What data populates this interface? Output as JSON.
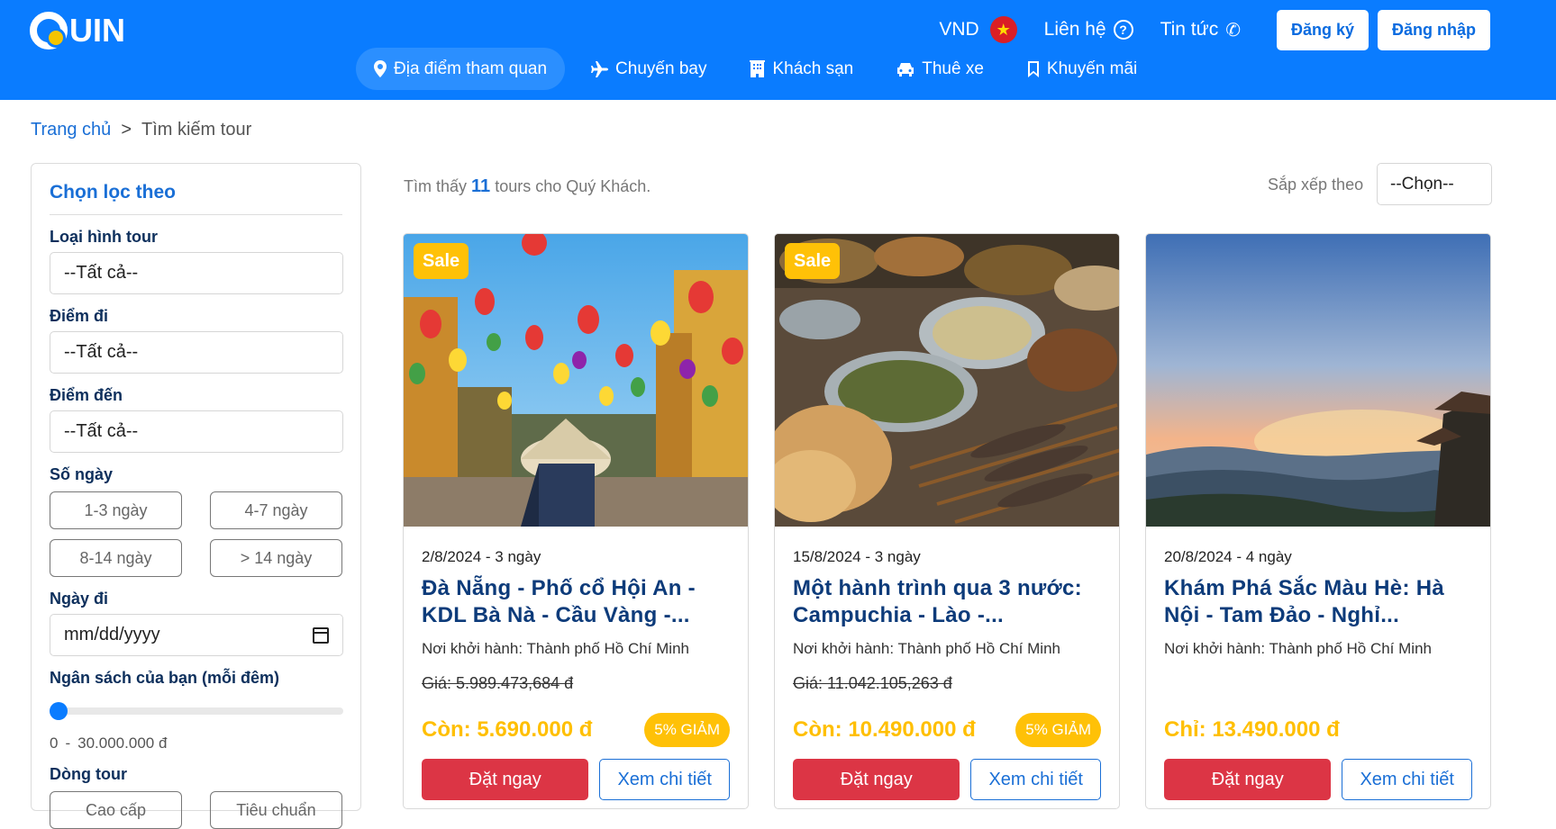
{
  "header": {
    "logo_text": "UIN",
    "currency": "VND",
    "contact": "Liên hệ",
    "news": "Tin tức",
    "register": "Đăng ký",
    "login": "Đăng nhập",
    "nav": [
      {
        "label": "Địa điểm tham quan",
        "icon": "map-pin-icon"
      },
      {
        "label": "Chuyến bay",
        "icon": "plane-icon"
      },
      {
        "label": "Khách sạn",
        "icon": "hotel-icon"
      },
      {
        "label": "Thuê xe",
        "icon": "car-icon"
      },
      {
        "label": "Khuyến mãi",
        "icon": "bookmark-icon"
      }
    ]
  },
  "breadcrumb": {
    "home": "Trang chủ",
    "separator": ">",
    "current": "Tìm kiếm tour"
  },
  "filter": {
    "title": "Chọn lọc theo",
    "tour_type_label": "Loại hình tour",
    "tour_type_value": "--Tất cả--",
    "departure_label": "Điểm đi",
    "departure_value": "--Tất cả--",
    "destination_label": "Điểm đến",
    "destination_value": "--Tất cả--",
    "days_label": "Số ngày",
    "days_options": [
      "1-3 ngày",
      "4-7 ngày",
      "8-14 ngày",
      "> 14 ngày"
    ],
    "date_label": "Ngày đi",
    "date_placeholder": "mm/dd/yyyy",
    "budget_label": "Ngân sách của bạn (mỗi đêm)",
    "budget_min": "0",
    "budget_dash": "-",
    "budget_max": "30.000.000 đ",
    "budget_level": 0,
    "line_label": "Dòng tour",
    "line_options": [
      "Cao cấp",
      "Tiêu chuẩn"
    ]
  },
  "results": {
    "prefix": "Tìm thấy",
    "count": "11",
    "suffix": "tours cho Quý Khách.",
    "sort_label": "Sắp xếp theo",
    "sort_value": "--Chọn--"
  },
  "tours": [
    {
      "badge": "Sale",
      "date": "2/8/2024 - 3 ngày",
      "title": "Đà Nẵng - Phố cổ Hội An - KDL Bà Nà - Cầu Vàng -...",
      "from": "Nơi khởi hành: Thành phố Hồ Chí Minh",
      "old_price": "Giá: 5.989.473,684 đ",
      "price": "Còn: 5.690.000 đ",
      "discount": "5% GIẢM",
      "book": "Đặt ngay",
      "detail": "Xem chi tiết"
    },
    {
      "badge": "Sale",
      "date": "15/8/2024 - 3 ngày",
      "title": "Một hành trình qua 3 nước: Campuchia - Lào -...",
      "from": "Nơi khởi hành: Thành phố Hồ Chí Minh",
      "old_price": "Giá: 11.042.105,263 đ",
      "price": "Còn: 10.490.000 đ",
      "discount": "5% GIẢM",
      "book": "Đặt ngay",
      "detail": "Xem chi tiết"
    },
    {
      "badge": "",
      "date": "20/8/2024 - 4 ngày",
      "title": "Khám Phá Sắc Màu Hè: Hà Nội - Tam Đảo - Nghỉ...",
      "from": "Nơi khởi hành: Thành phố Hồ Chí Minh",
      "old_price": "",
      "price": "Chỉ: 13.490.000 đ",
      "discount": "",
      "book": "Đặt ngay",
      "detail": "Xem chi tiết"
    }
  ]
}
